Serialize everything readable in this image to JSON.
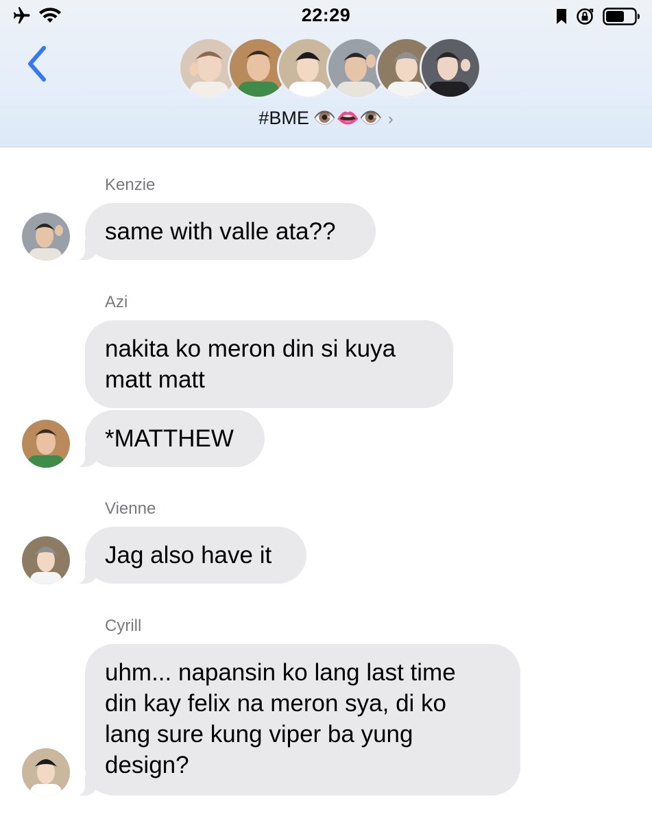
{
  "status_bar": {
    "time": "22:29",
    "icons": [
      "airplane-icon",
      "wifi-icon",
      "bookmark-icon",
      "orientation-lock-icon",
      "battery-icon"
    ]
  },
  "header": {
    "group_name": "#BME",
    "group_emoji": "👁️👄👁️",
    "chevron": "›",
    "avatars": [
      {
        "name": "member-1",
        "bg": "#d9c7b8",
        "accent": "#f3efe8"
      },
      {
        "name": "member-2",
        "bg": "#b98a5c",
        "accent": "#3f8c4a"
      },
      {
        "name": "member-3",
        "bg": "#c9b79e",
        "accent": "#ffffff"
      },
      {
        "name": "member-4",
        "bg": "#9aa0a8",
        "accent": "#e8e4dc"
      },
      {
        "name": "member-5",
        "bg": "#8d7b63",
        "accent": "#f4f4f4"
      },
      {
        "name": "member-6",
        "bg": "#5d5f66",
        "accent": "#1f1f24"
      }
    ]
  },
  "messages": {
    "groups": [
      {
        "sender": "Kenzie",
        "bubbles": [
          "same with valle ata??"
        ]
      },
      {
        "sender": "Azi",
        "bubbles": [
          "nakita ko meron din si kuya matt matt",
          "*MATTHEW"
        ]
      },
      {
        "sender": "Vienne",
        "bubbles": [
          "Jag also have it"
        ]
      },
      {
        "sender": "Cyrill",
        "bubbles": [
          "uhm... napansin ko lang last time din kay felix na meron sya, di ko lang sure kung viper ba yung design?"
        ]
      }
    ],
    "cyrill_lines": [
      "uhm... napansin ko lang last time",
      "din kay felix na meron sya, di ko",
      "lang sure kung viper ba yung",
      "design?"
    ],
    "azi_lines": [
      "nakita ko meron din si kuya",
      "matt matt"
    ]
  },
  "colors": {
    "accent_blue": "#3478f6",
    "bubble_gray": "#e9e9eb",
    "sender_gray": "#767a80"
  }
}
